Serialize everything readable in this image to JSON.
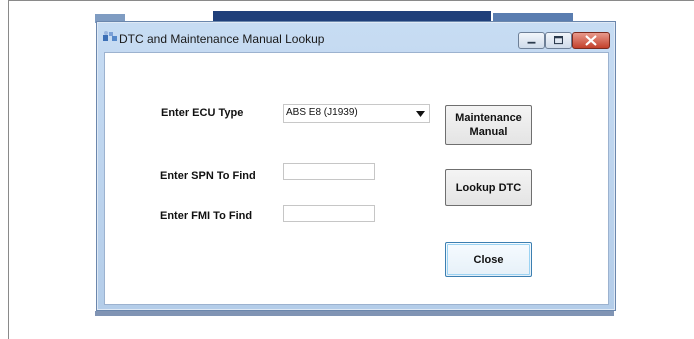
{
  "window": {
    "title": "DTC and Maintenance Manual Lookup",
    "icon": "app-icon",
    "caption_buttons": [
      "minimize-icon",
      "maximize-icon",
      "close-icon"
    ]
  },
  "form": {
    "ecu_label": "Enter ECU Type",
    "ecu_value": "ABS E8 (J1939)",
    "spn_label": "Enter SPN To Find",
    "spn_value": "",
    "fmi_label": "Enter FMI To Find",
    "fmi_value": ""
  },
  "buttons": {
    "maintenance_line1": "Maintenance",
    "maintenance_line2": "Manual",
    "lookup": "Lookup DTC",
    "close": "Close"
  },
  "colors": {
    "titlebar": "#c7dcf3",
    "close_button": "#c3402b",
    "focus_border": "#3c7fb1"
  }
}
